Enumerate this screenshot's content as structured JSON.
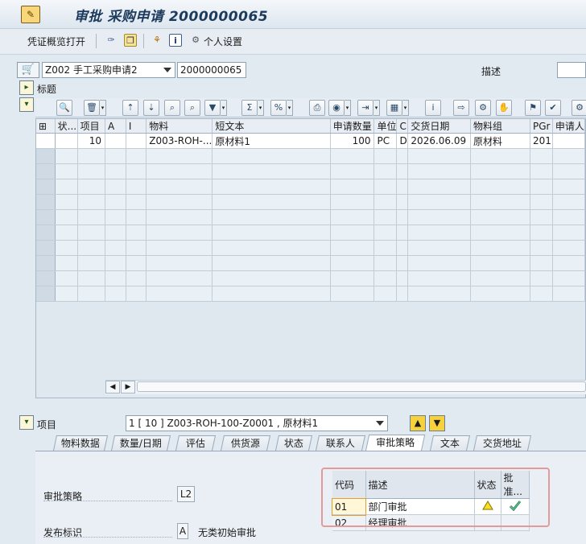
{
  "window": {
    "title": "审批 采购申请 2000000065"
  },
  "toolbar": {
    "doc_overview": "凭证概览打开",
    "personal_settings": "个人设置"
  },
  "header": {
    "doc_type": "Z002 手工采购申请2",
    "doc_number": "2000000065",
    "desc_label": "描述",
    "title_label": "标题"
  },
  "grid": {
    "columns": [
      "",
      "状...",
      "项目",
      "A",
      "I",
      "物料",
      "短文本",
      "申请数量",
      "单位",
      "C",
      "交货日期",
      "物料组",
      "PGr",
      "申请人"
    ],
    "rows": [
      [
        "",
        "",
        "10",
        "",
        "",
        "Z003-ROH-...",
        "原材料1",
        "100",
        "PC",
        "D",
        "2026.06.09",
        "原材料",
        "201",
        ""
      ]
    ]
  },
  "item": {
    "label": "项目",
    "selected": "1 [ 10 ] Z003-ROH-100-Z0001 , 原材料1"
  },
  "tabs": [
    "物料数据",
    "数量/日期",
    "评估",
    "供货源",
    "状态",
    "联系人",
    "审批策略",
    "文本",
    "交货地址"
  ],
  "active_tab": "审批策略",
  "release": {
    "strategy_label": "审批策略",
    "strategy_value": "L2",
    "indicator_label": "发布标识",
    "indicator_value": "A",
    "indicator_text": "无类初始审批"
  },
  "approval_table": {
    "headers": [
      "代码",
      "描述",
      "状态",
      "批准..."
    ],
    "rows": [
      {
        "code": "01",
        "desc": "部门审批",
        "status": "warning-triangle",
        "approve": "approve-check"
      },
      {
        "code": "02",
        "desc": "经理审批",
        "status": "",
        "approve": ""
      }
    ]
  }
}
